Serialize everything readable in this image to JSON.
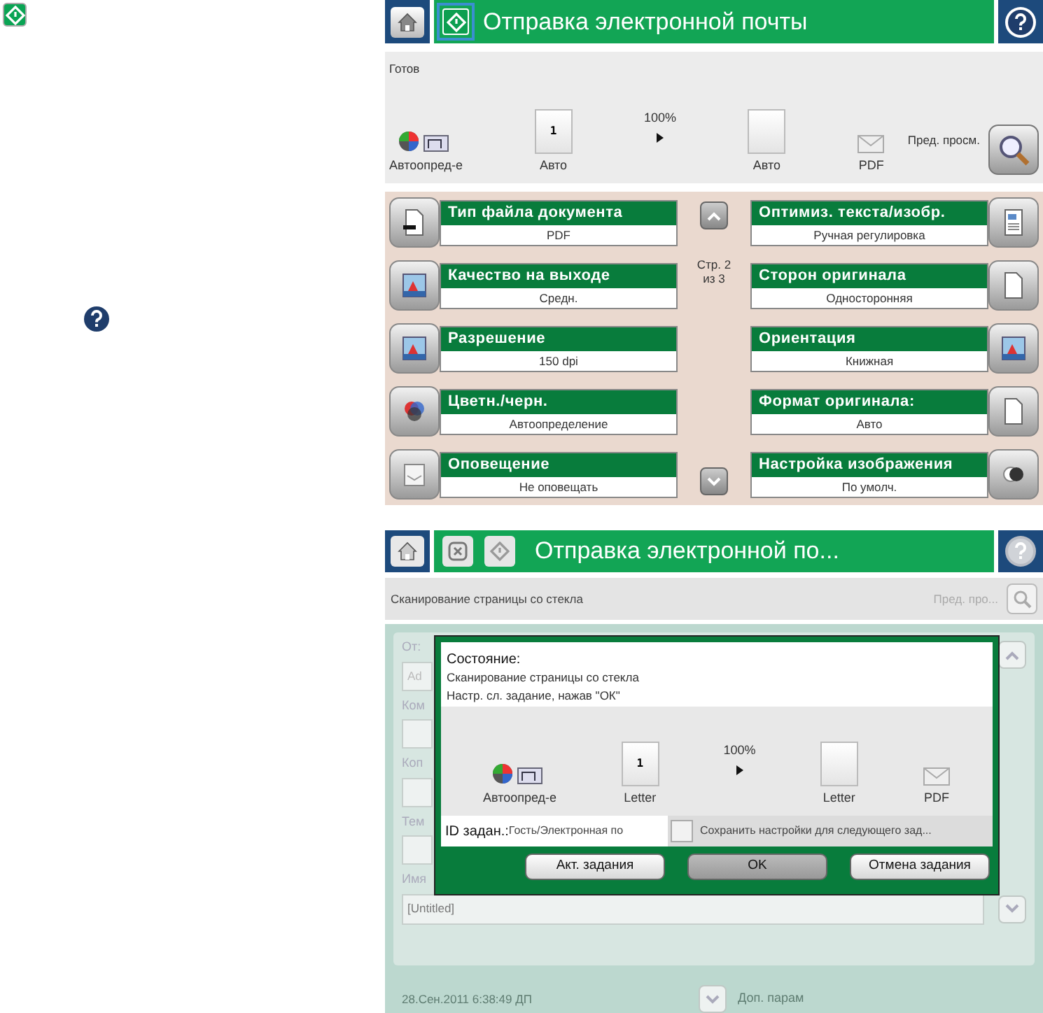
{
  "screen_1": {
    "start_highlighted": true,
    "title": "Отправка электронной почты",
    "status": "Готов",
    "preview": {
      "scale": "100%",
      "items": [
        {
          "kind": "color",
          "label": "Автоопред-е"
        },
        {
          "kind": "page",
          "number": "1",
          "label": "Авто"
        },
        {
          "kind": "page",
          "label": "Авто"
        },
        {
          "kind": "format",
          "label": "PDF"
        }
      ]
    },
    "preview_label": "Пред. просм.",
    "options_left": [
      {
        "title": "Тип файла документа",
        "value": "PDF"
      },
      {
        "title": "Качество на выходе",
        "value": "Средн."
      },
      {
        "title": "Разрешение",
        "value": "150 dpi"
      },
      {
        "title": "Цветн./черн.",
        "value": "Автоопределение"
      },
      {
        "title": "Оповещение",
        "value": "Не оповещать"
      }
    ],
    "page_indicator": "Стр. 2",
    "page_total": "из 3",
    "options_right": [
      {
        "title": "Оптимиз. текста/изобр.",
        "value": "Ручная регулировка"
      },
      {
        "title": "Сторон оригинала",
        "value": "Односторонняя"
      },
      {
        "title": "Ориентация",
        "value": "Книжная"
      },
      {
        "title": "Формат оригинала:",
        "value": "Авто"
      },
      {
        "title": "Настройка изображения",
        "value": "По умолч."
      }
    ]
  },
  "screen_2": {
    "title": "Отправка электронной по...",
    "status": "Сканирование страницы со стекла",
    "preview_label": "Пред. про...",
    "form_labels": [
      "От:",
      "Ком",
      "Коп",
      "Тем",
      "Имя"
    ],
    "from_value": "Ad",
    "name_value": "[Untitled]",
    "timestamp": "28.Сен.2011 6:38:49 ДП",
    "more_options": "Доп. парам",
    "dialog": {
      "heading": "Состояние:",
      "lines": [
        "Сканирование страницы со стекла",
        "Настр. сл. задание, нажав \"ОК\""
      ],
      "preview": {
        "scale": "100%",
        "items": [
          {
            "kind": "color",
            "label": "Автоопред-е"
          },
          {
            "kind": "page",
            "number": "1",
            "label": "Letter"
          },
          {
            "kind": "page",
            "label": "Letter"
          },
          {
            "kind": "format",
            "label": "PDF"
          }
        ]
      },
      "job_id_label": "ID задан.:",
      "job_id_value": "Гость/Электронная по",
      "save_settings": {
        "label": "Сохранить настройки для следующего зад...",
        "checked": false
      },
      "buttons": [
        {
          "label": "Акт. задания",
          "selected": false
        },
        {
          "label": "OK",
          "selected": true
        },
        {
          "label": "Отмена задания",
          "selected": false
        }
      ]
    }
  }
}
